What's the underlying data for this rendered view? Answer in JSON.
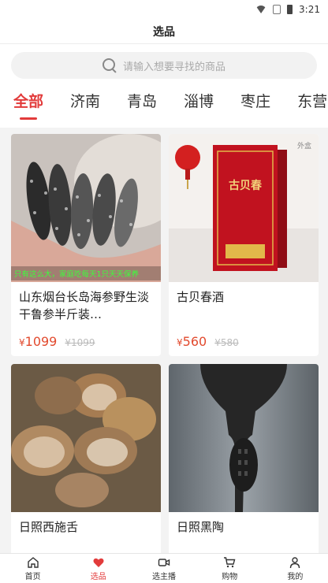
{
  "status_bar": {
    "time": "3:21"
  },
  "header": {
    "title": "选品"
  },
  "search": {
    "placeholder": "请输入想要寻找的商品"
  },
  "tabs": [
    {
      "label": "全部",
      "active": true
    },
    {
      "label": "济南",
      "active": false
    },
    {
      "label": "青岛",
      "active": false
    },
    {
      "label": "淄博",
      "active": false
    },
    {
      "label": "枣庄",
      "active": false
    },
    {
      "label": "东营",
      "active": false
    }
  ],
  "products": [
    {
      "name": "山东烟台长岛海参野生淡干鲁参半斤装…",
      "price": "1099",
      "original_price": "¥1099",
      "image_caption": "只有这么大，家庭吃每天1只天天保养"
    },
    {
      "name": "古贝春酒",
      "price": "560",
      "original_price": "¥580",
      "image_label": "外盒",
      "box_text": "古贝春"
    },
    {
      "name": "日照西施舌",
      "price": "",
      "original_price": ""
    },
    {
      "name": "日照黑陶",
      "price": "",
      "original_price": ""
    }
  ],
  "currency_symbol": "¥",
  "nav": [
    {
      "label": "首页",
      "icon": "home-icon",
      "active": false
    },
    {
      "label": "选品",
      "icon": "heart-icon",
      "active": true
    },
    {
      "label": "选主播",
      "icon": "video-icon",
      "active": false
    },
    {
      "label": "购物",
      "icon": "cart-icon",
      "active": false
    },
    {
      "label": "我的",
      "icon": "person-icon",
      "active": false
    }
  ],
  "colors": {
    "accent": "#e23b3b",
    "price": "#e24a2e"
  }
}
